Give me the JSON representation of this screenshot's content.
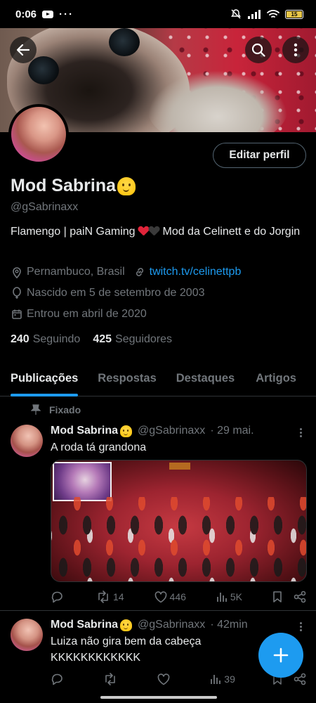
{
  "status_bar": {
    "time": "0:06",
    "dots": "···",
    "battery": "15"
  },
  "banner": {},
  "profile": {
    "name": "Mod Sabrina",
    "handle": "@gSabrinaxx",
    "edit_button": "Editar perfil",
    "bio_part1": "Flamengo | paiN Gaming",
    "bio_part2": "Mod da Celinett e do Jorgin",
    "location": "Pernambuco, Brasil",
    "website": "twitch.tv/celinettpb",
    "birth": "Nascido em 5 de setembro de 2003",
    "joined": "Entrou em abril de 2020",
    "following_count": "240",
    "following_label": "Seguindo",
    "followers_count": "425",
    "followers_label": "Seguidores"
  },
  "tabs": [
    "Publicações",
    "Respostas",
    "Destaques",
    "Artigos"
  ],
  "pinned_label": "Fixado",
  "posts": [
    {
      "name": "Mod Sabrina",
      "handle": "@gSabrinaxx",
      "time": "· 29 mai.",
      "text": "A roda tá grandona",
      "replies": "",
      "reposts": "14",
      "likes": "446",
      "views": "5K"
    },
    {
      "name": "Mod Sabrina",
      "handle": "@gSabrinaxx",
      "time": "· 42min",
      "text": "Luiza não gira bem da cabeça KKKKKKKKKKKK",
      "replies": "",
      "reposts": "",
      "likes": "",
      "views": "39"
    }
  ],
  "colors": {
    "accent": "#1d9bf0",
    "background": "#000000",
    "muted": "#71767b",
    "text": "#e7e9ea"
  },
  "icons": {
    "back": "arrow-left-icon",
    "search": "search-icon",
    "more": "more-vertical-icon",
    "location": "location-pin-icon",
    "link": "link-icon",
    "birth": "balloon-icon",
    "calendar": "calendar-icon",
    "pin": "pin-icon",
    "reply": "reply-icon",
    "repost": "repost-icon",
    "like": "heart-icon",
    "views": "bar-chart-icon",
    "bookmark": "bookmark-icon",
    "share": "share-icon",
    "compose": "plus-icon"
  }
}
